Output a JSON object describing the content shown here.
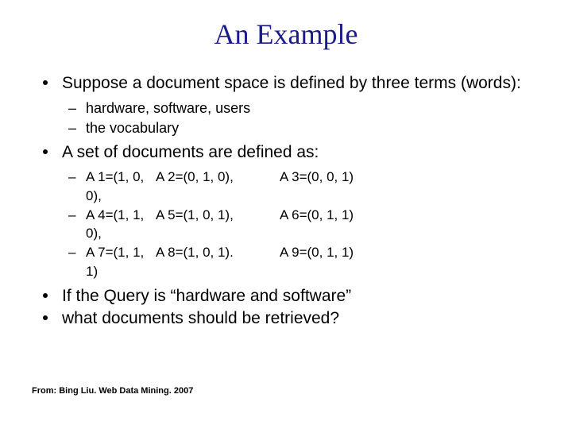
{
  "title": "An Example",
  "bullets": {
    "b1": "Suppose a document space is defined by three terms (words):",
    "b1_sub1": "hardware, software, users",
    "b1_sub2": "the vocabulary",
    "b2": "A set of documents are defined as:",
    "b3": "If the Query is “hardware and software”",
    "b4": "what documents should be retrieved?"
  },
  "docs": {
    "r1c1": "A 1=(1, 0, 0),",
    "r1c2": "A 2=(0, 1, 0),",
    "r1c3": "A 3=(0, 0, 1)",
    "r2c1": "A 4=(1, 1, 0),",
    "r2c2": "A 5=(1, 0, 1),",
    "r2c3": "A 6=(0, 1, 1)",
    "r3c1": "A 7=(1, 1, 1)",
    "r3c2": "A 8=(1, 0, 1).",
    "r3c3": "A 9=(0, 1, 1)"
  },
  "attribution": "From: Bing Liu. Web Data Mining. 2007"
}
